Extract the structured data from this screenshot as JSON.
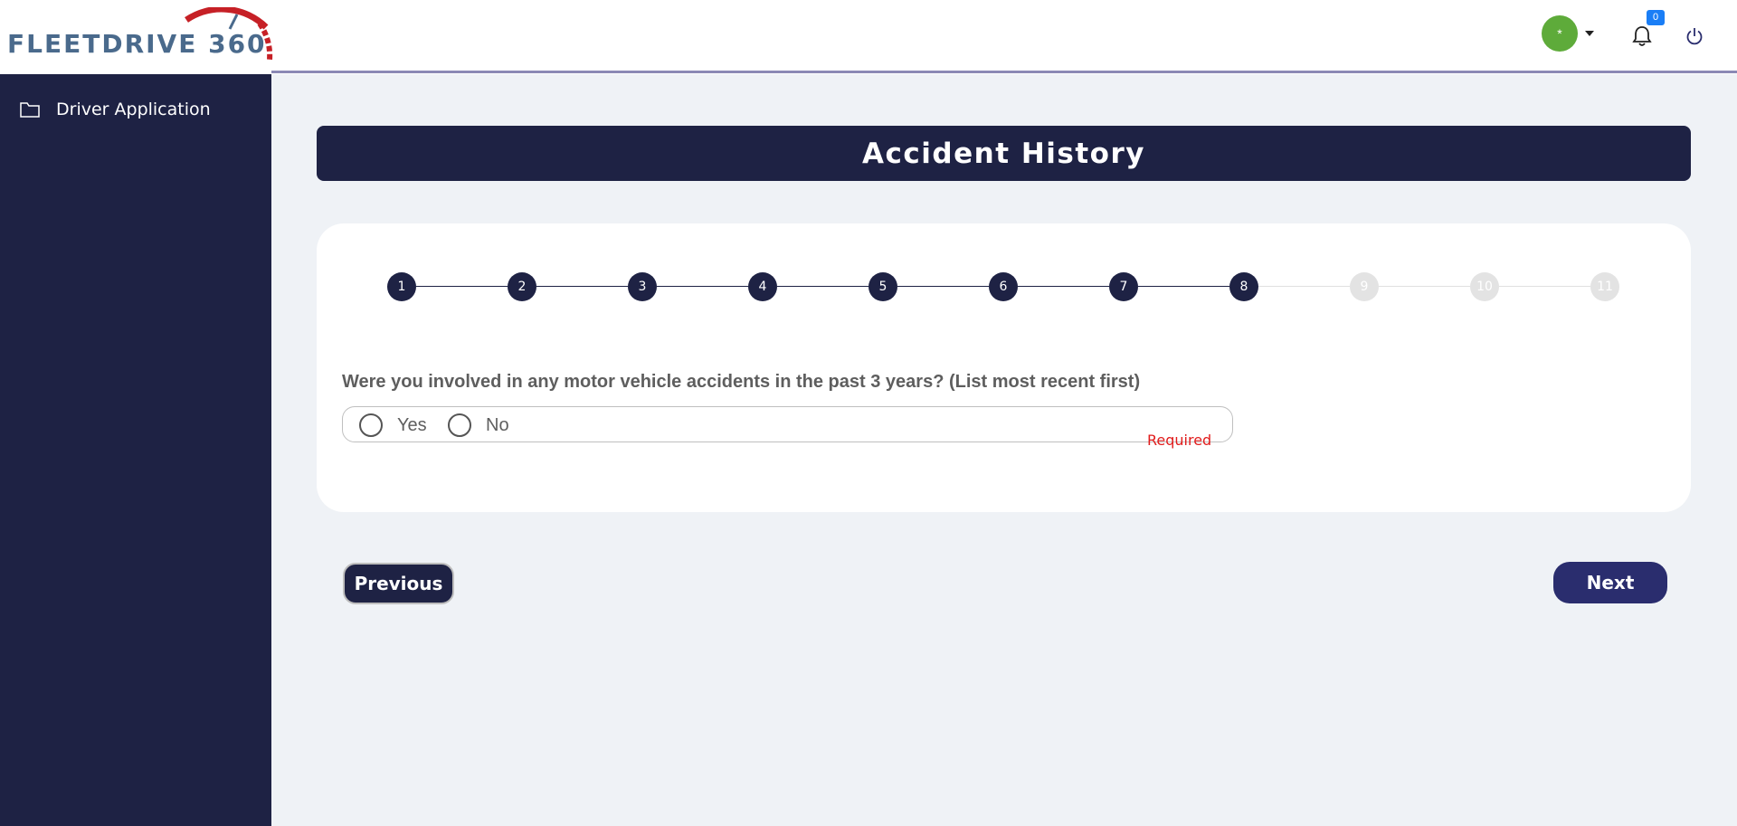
{
  "header": {
    "logo_text": "FLEETDRIVE 360",
    "avatar_initial": "*",
    "notification_count": "0"
  },
  "sidebar": {
    "items": [
      {
        "label": "Driver Application",
        "icon": "folder-icon"
      }
    ]
  },
  "page": {
    "title": "Accident History"
  },
  "stepper": {
    "steps": [
      "1",
      "2",
      "3",
      "4",
      "5",
      "6",
      "7",
      "8",
      "9",
      "10",
      "11"
    ],
    "current_step": 8
  },
  "form": {
    "question": "Were you involved in any motor vehicle accidents in the past 3 years? (List most recent first)",
    "options": [
      "Yes",
      "No"
    ],
    "selected": null,
    "validation": "Required"
  },
  "buttons": {
    "previous": "Previous",
    "next": "Next"
  },
  "colors": {
    "navy": "#1e2244",
    "accent_button": "#2a2d6e",
    "avatar_green": "#5eab3a",
    "badge_blue": "#1a7ef6",
    "required_red": "#e11c1c",
    "background": "#eff2f6"
  }
}
